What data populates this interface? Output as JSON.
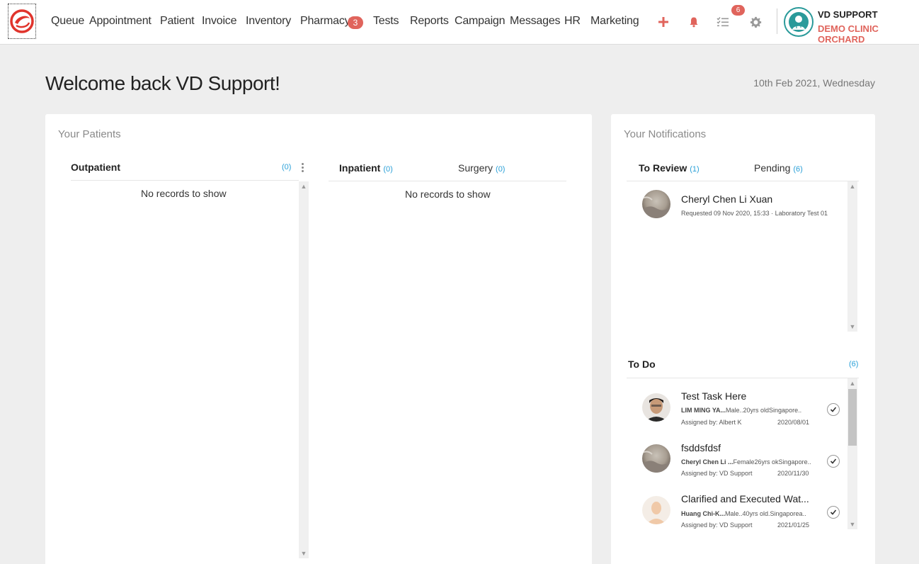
{
  "nav": {
    "items": [
      "Queue",
      "Appointment",
      "Patient",
      "Invoice",
      "Inventory",
      "Pharmacy",
      "Tests",
      "Reports",
      "Campaign",
      "Messages",
      "HR",
      "Marketing"
    ],
    "pharmacy_badge": "3",
    "tasks_badge": "6"
  },
  "user": {
    "name": "VD SUPPORT",
    "clinic": "DEMO CLINIC ORCHARD"
  },
  "header": {
    "welcome": "Welcome back VD Support!",
    "date": "10th Feb 2021, Wednesday"
  },
  "patients": {
    "title": "Your Patients",
    "outpatient": {
      "label": "Outpatient",
      "count": "(0)",
      "empty": "No records to show"
    },
    "inpatient": {
      "label": "Inpatient",
      "count": "(0)"
    },
    "surgery": {
      "label": "Surgery",
      "count": "(0)"
    },
    "inpatient_empty": "No records to show"
  },
  "notifications": {
    "title": "Your Notifications",
    "tabs": {
      "review_label": "To Review",
      "review_count": "(1)",
      "pending_label": "Pending",
      "pending_count": "(6)"
    },
    "review_items": [
      {
        "name": "Cheryl Chen Li Xuan",
        "meta": "Requested 09 Nov 2020, 15:33  ·  Laboratory Test 01"
      }
    ],
    "todo": {
      "label": "To Do",
      "count": "(6)",
      "items": [
        {
          "title": "Test Task Here",
          "patient": "LIM MING YA...",
          "info": "Male..20yrs oldSingapore..",
          "assigned": "Assigned by: Albert K",
          "date": "2020/08/01"
        },
        {
          "title": "fsddsfdsf",
          "patient": "Cheryl Chen Li ...",
          "info": "Female26yrs okSingapore..",
          "assigned": "Assigned by: VD Support",
          "date": "2020/11/30"
        },
        {
          "title": "Clarified and Executed Wat...",
          "patient": "Huang Chi-K...",
          "info": "Male..40yrs old.Singaporea..",
          "assigned": "Assigned by: VD Support",
          "date": "2021/01/25"
        }
      ]
    }
  },
  "colors": {
    "accent": "#e0645c",
    "count_blue": "#2aa0d8",
    "teal": "#2a9a9a"
  }
}
